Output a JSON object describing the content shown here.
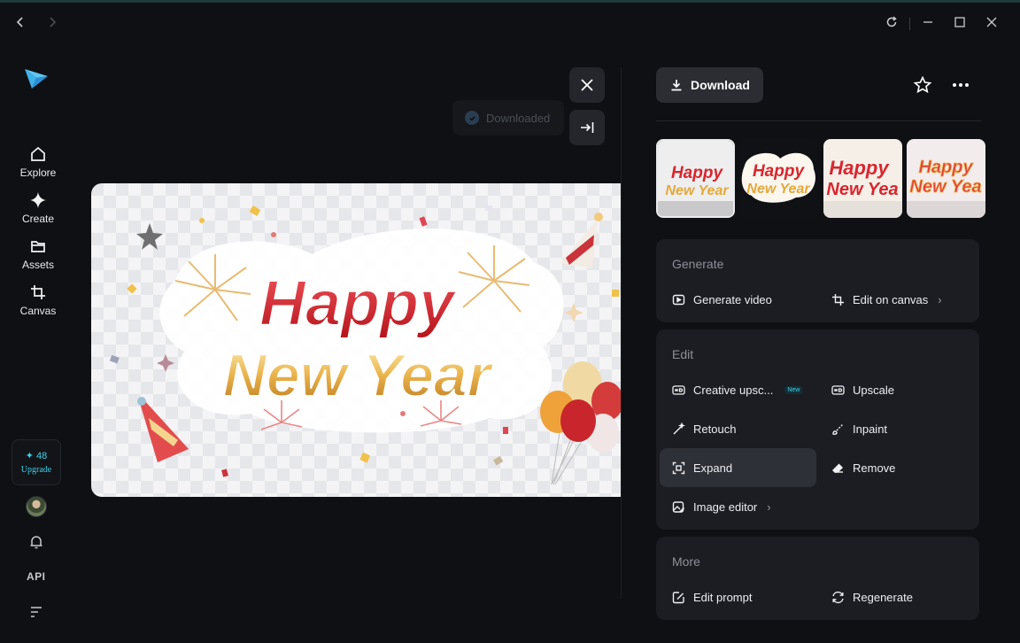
{
  "window": {
    "back_icon": "arrow-left-icon",
    "forward_icon": "arrow-right-icon",
    "reload_icon": "reload-icon",
    "minimize_icon": "minimize-icon",
    "maximize_icon": "maximize-icon",
    "close_icon": "close-icon"
  },
  "nav": {
    "items": [
      {
        "label": "Explore",
        "icon": "home-icon"
      },
      {
        "label": "Create",
        "icon": "sparkle-icon"
      },
      {
        "label": "Assets",
        "icon": "folder-icon"
      },
      {
        "label": "Canvas",
        "icon": "crop-icon"
      }
    ],
    "credits": "48",
    "upgrade_label": "Upgrade",
    "api_label": "API"
  },
  "canvas": {
    "toast": "Downloaded",
    "image_text": [
      "Happy",
      "New Year"
    ]
  },
  "panel": {
    "download_label": "Download",
    "thumbnails": [
      {
        "line1": "Happy",
        "line2": "New Year",
        "selected": true
      },
      {
        "line1": "Happy",
        "line2": "New Year",
        "selected": false
      },
      {
        "line1": "Happy",
        "line2": "New Yea",
        "selected": false
      },
      {
        "line1": "Happy",
        "line2": "New Yea",
        "selected": false
      }
    ],
    "generate": {
      "title": "Generate",
      "generate_video": "Generate video",
      "edit_on_canvas": "Edit on canvas"
    },
    "edit": {
      "title": "Edit",
      "creative_upscale": "Creative upsc...",
      "new_badge": "New",
      "upscale": "Upscale",
      "retouch": "Retouch",
      "inpaint": "Inpaint",
      "expand": "Expand",
      "remove": "Remove",
      "image_editor": "Image editor"
    },
    "more": {
      "title": "More",
      "edit_prompt": "Edit prompt",
      "regenerate": "Regenerate"
    }
  },
  "colors": {
    "accent": "#3fd0e6",
    "background": "#0f1013",
    "card": "#1c1d22",
    "title_red": "#d8262e",
    "title_gold": "#e2a93a"
  }
}
